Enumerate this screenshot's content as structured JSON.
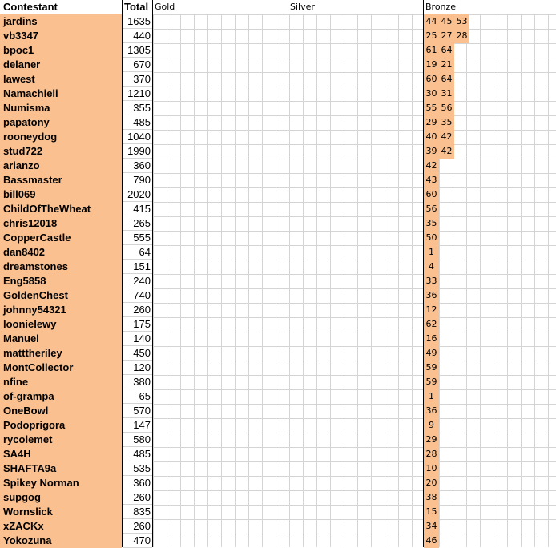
{
  "headers": {
    "contestant": "Contestant",
    "total": "Total",
    "gold": "Gold",
    "silver": "Silver",
    "bronze": "Bronze"
  },
  "colors": {
    "highlight": "#fac090",
    "gridline": "#d4d4d4"
  },
  "rows": [
    {
      "name": "jardins",
      "total": "1635",
      "bronze": [
        "44",
        "45",
        "53"
      ]
    },
    {
      "name": "vb3347",
      "total": "440",
      "bronze": [
        "25",
        "27",
        "28"
      ]
    },
    {
      "name": "bpoc1",
      "total": "1305",
      "bronze": [
        "61",
        "64"
      ]
    },
    {
      "name": "delaner",
      "total": "670",
      "bronze": [
        "19",
        "21"
      ]
    },
    {
      "name": "lawest",
      "total": "370",
      "bronze": [
        "60",
        "64"
      ]
    },
    {
      "name": "Namachieli",
      "total": "1210",
      "bronze": [
        "30",
        "31"
      ]
    },
    {
      "name": "Numisma",
      "total": "355",
      "bronze": [
        "55",
        "56"
      ]
    },
    {
      "name": "papatony",
      "total": "485",
      "bronze": [
        "29",
        "35"
      ]
    },
    {
      "name": "rooneydog",
      "total": "1040",
      "bronze": [
        "40",
        "42"
      ]
    },
    {
      "name": "stud722",
      "total": "1990",
      "bronze": [
        "39",
        "42"
      ]
    },
    {
      "name": "arianzo",
      "total": "360",
      "bronze": [
        "42"
      ]
    },
    {
      "name": "Bassmaster",
      "total": "790",
      "bronze": [
        "43"
      ]
    },
    {
      "name": "bill069",
      "total": "2020",
      "bronze": [
        "60"
      ]
    },
    {
      "name": "ChildOfTheWheat",
      "total": "415",
      "bronze": [
        "56"
      ]
    },
    {
      "name": "chris12018",
      "total": "265",
      "bronze": [
        "35"
      ]
    },
    {
      "name": "CopperCastle",
      "total": "555",
      "bronze": [
        "50"
      ]
    },
    {
      "name": "dan8402",
      "total": "64",
      "bronze": [
        "1"
      ]
    },
    {
      "name": "dreamstones",
      "total": "151",
      "bronze": [
        "4"
      ]
    },
    {
      "name": "Eng5858",
      "total": "240",
      "bronze": [
        "33"
      ]
    },
    {
      "name": "GoldenChest",
      "total": "740",
      "bronze": [
        "36"
      ]
    },
    {
      "name": "johnny54321",
      "total": "260",
      "bronze": [
        "12"
      ]
    },
    {
      "name": "loonielewy",
      "total": "175",
      "bronze": [
        "62"
      ]
    },
    {
      "name": "Manuel",
      "total": "140",
      "bronze": [
        "16"
      ]
    },
    {
      "name": "matttheriley",
      "total": "450",
      "bronze": [
        "49"
      ]
    },
    {
      "name": "MontCollector",
      "total": "120",
      "bronze": [
        "59"
      ]
    },
    {
      "name": "nfine",
      "total": "380",
      "bronze": [
        "59"
      ]
    },
    {
      "name": "of-grampa",
      "total": "65",
      "bronze": [
        "1"
      ]
    },
    {
      "name": "OneBowl",
      "total": "570",
      "bronze": [
        "36"
      ]
    },
    {
      "name": "Podoprigora",
      "total": "147",
      "bronze": [
        "9"
      ]
    },
    {
      "name": "rycolemet",
      "total": "580",
      "bronze": [
        "29"
      ]
    },
    {
      "name": "SA4H",
      "total": "485",
      "bronze": [
        "28"
      ]
    },
    {
      "name": "SHAFTA9a",
      "total": "535",
      "bronze": [
        "10"
      ]
    },
    {
      "name": "Spikey Norman",
      "total": "360",
      "bronze": [
        "20"
      ]
    },
    {
      "name": "supgog",
      "total": "260",
      "bronze": [
        "38"
      ]
    },
    {
      "name": "Wornslick",
      "total": "835",
      "bronze": [
        "15"
      ]
    },
    {
      "name": "xZACKx",
      "total": "260",
      "bronze": [
        "34"
      ]
    },
    {
      "name": "Yokozuna",
      "total": "470",
      "bronze": [
        "46"
      ]
    }
  ]
}
